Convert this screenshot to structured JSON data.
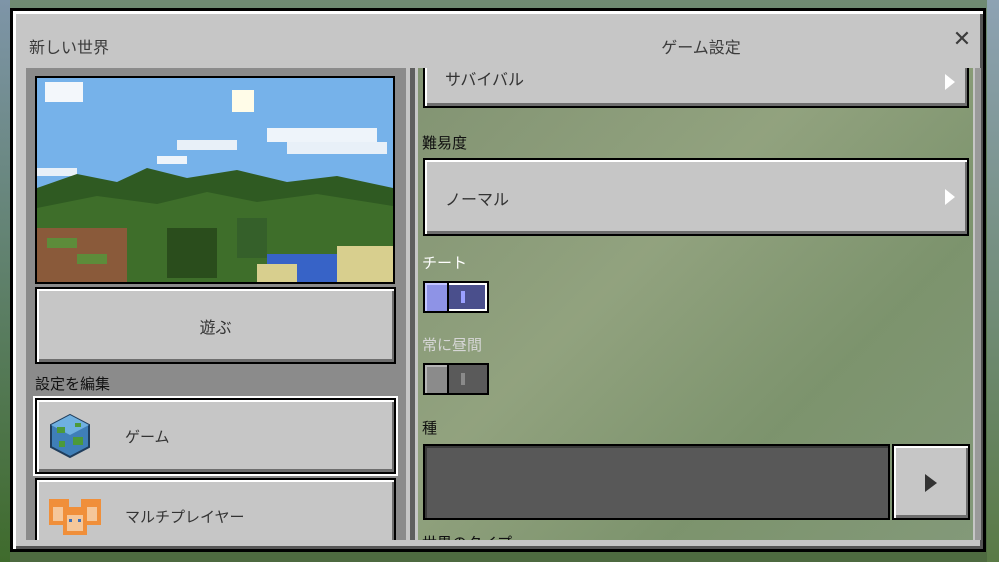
{
  "window": {
    "title_left": "新しい世界",
    "title_center": "ゲーム設定"
  },
  "left": {
    "play_label": "遊ぶ",
    "edit_settings_label": "設定を編集",
    "nav_items": [
      {
        "label": "ゲーム",
        "icon": "globe-icon",
        "selected": true
      },
      {
        "label": "マルチプレイヤー",
        "icon": "players-icon",
        "selected": false
      }
    ]
  },
  "right": {
    "game_mode_value": "サバイバル",
    "difficulty_label": "難易度",
    "difficulty_value": "ノーマル",
    "cheats_label": "チート",
    "cheats_on": true,
    "always_day_label": "常に昼間",
    "always_day_on": false,
    "seed_label": "種",
    "seed_value": "",
    "world_type_label": "世界のタイプ"
  },
  "colors": {
    "panel": "#c6c6c6",
    "toggle_on": "#4a4f8c",
    "toggle_knob_on": "#8e93e6",
    "seed_field": "#585858"
  }
}
